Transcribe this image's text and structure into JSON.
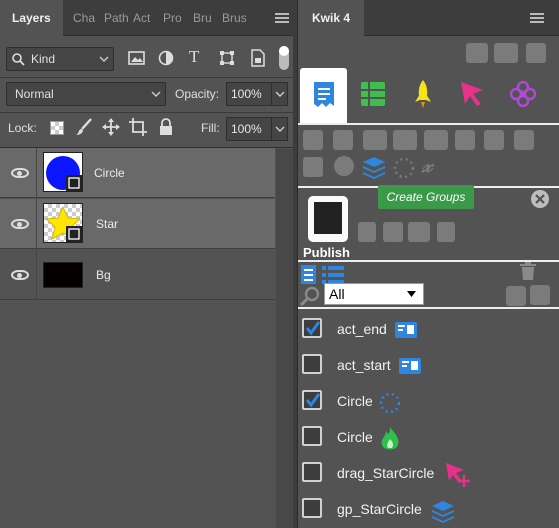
{
  "layers_panel": {
    "tabs": [
      "Layers",
      "Cha",
      "Path",
      "Act",
      "Pro",
      "Bru",
      "Brus"
    ],
    "filter": {
      "value": "Kind"
    },
    "blend_mode": {
      "value": "Normal"
    },
    "opacity": {
      "label": "Opacity:",
      "value": "100%"
    },
    "lock": {
      "label": "Lock:"
    },
    "fill": {
      "label": "Fill:",
      "value": "100%"
    },
    "layers": [
      {
        "name": "Circle"
      },
      {
        "name": "Star"
      },
      {
        "name": "Bg"
      }
    ]
  },
  "kwik_panel": {
    "title": "Kwik 4",
    "tooltip": "Create Groups",
    "publish_label": "Publish",
    "filter": {
      "value": "All"
    },
    "items": [
      {
        "label": "act_end",
        "checked": true
      },
      {
        "label": "act_start",
        "checked": false
      },
      {
        "label": "Circle",
        "checked": true
      },
      {
        "label": "Circle",
        "checked": false
      },
      {
        "label": "drag_StarCircle",
        "checked": false
      },
      {
        "label": "gp_StarCircle",
        "checked": false
      }
    ]
  },
  "colors": {
    "accent_blue": "#1e88e5",
    "green": "#2e9e47",
    "panel": "#535353",
    "selected": "#696969"
  }
}
